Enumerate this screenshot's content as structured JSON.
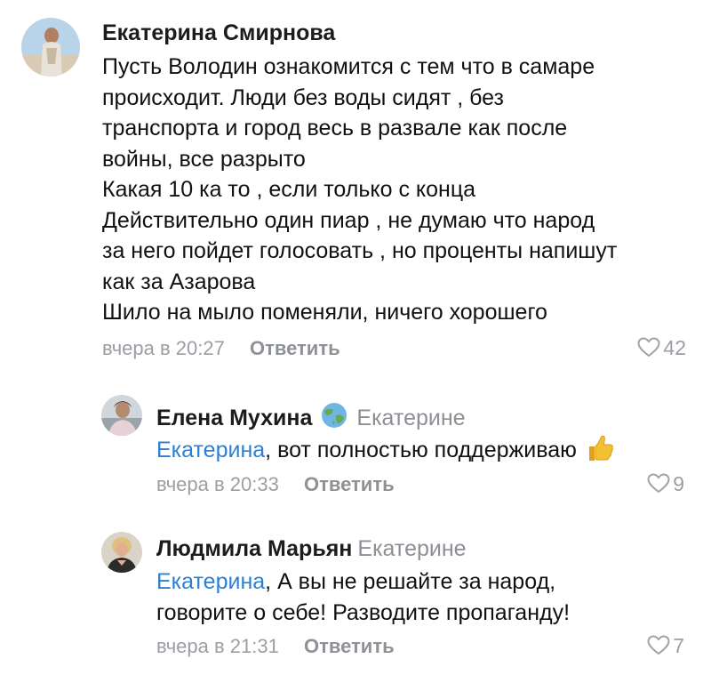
{
  "comments": [
    {
      "author": "Екатерина Смирнова",
      "lines": [
        "Пусть Володин ознакомится с тем что в самаре",
        "происходит. Люди без воды сидят , без",
        "транспорта и город весь в развале как после",
        "войны, все разрыто",
        "Какая 10 ка то , если только с конца",
        "Действительно один пиар , не думаю что народ",
        "за него пойдет голосовать , но проценты напишут",
        "как за Азарова",
        "Шило на мыло поменяли, ничего хорошего"
      ],
      "time": "вчера в 20:27",
      "reply_label": "Ответить",
      "likes": "42",
      "avatar_icon": "user-photo-avatar"
    }
  ],
  "replies": [
    {
      "author": "Елена Мухина",
      "badge_icon": "globe-icon",
      "reply_to": "Екатерине",
      "mention": "Екатерина",
      "text_lines": [
        ", вот полностью поддерживаю"
      ],
      "emoji": "thumbs-up-icon",
      "time": "вчера в 20:33",
      "reply_label": "Ответить",
      "likes": "9"
    },
    {
      "author": "Людмила Марьян",
      "reply_to": "Екатерине",
      "mention": "Екатерина",
      "text_lines": [
        ", А вы не решайте за народ,",
        "говорите о себе! Разводите пропаганду!"
      ],
      "time": "вчера в 21:31",
      "reply_label": "Ответить",
      "likes": "7"
    }
  ],
  "colors": {
    "mention": "#2d7fd3",
    "meta": "#9b9ea3",
    "heart": "#a0a3a8"
  }
}
